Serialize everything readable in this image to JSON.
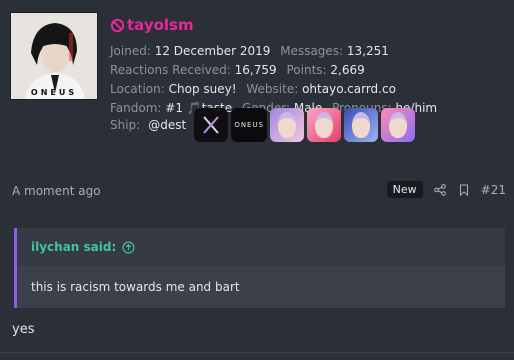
{
  "user": {
    "name": "tayolsm",
    "avatar_caption": "ONEUS",
    "stats": [
      {
        "label": "Joined:",
        "value": "12 December 2019"
      },
      {
        "label": "Messages:",
        "value": "13,251"
      },
      {
        "label": "Reactions Received:",
        "value": "16,759"
      },
      {
        "label": "Points:",
        "value": "2,669"
      },
      {
        "label": "Location:",
        "value": "Chop suey!"
      },
      {
        "label": "Website:",
        "value": "ohtayo.carrd.co"
      },
      {
        "label": "Fandom:",
        "value": "#1 🎵taste"
      },
      {
        "label": "Gender:",
        "value": "Male"
      },
      {
        "label": "Pronouns:",
        "value": "he/him"
      }
    ],
    "ship_label": "Ship:",
    "ship_value": "@dest",
    "badge_oneus": "ONEUS"
  },
  "post": {
    "time": "A moment ago",
    "new_label": "New",
    "number": "#21",
    "quote_author": "ilychan said:",
    "quote_text": "this is racism towards me and bart",
    "reply_text": "yes"
  },
  "colors": {
    "username": "#e6279a",
    "quote_author": "#3ec3a0",
    "quote_border": "#8e5de6"
  }
}
